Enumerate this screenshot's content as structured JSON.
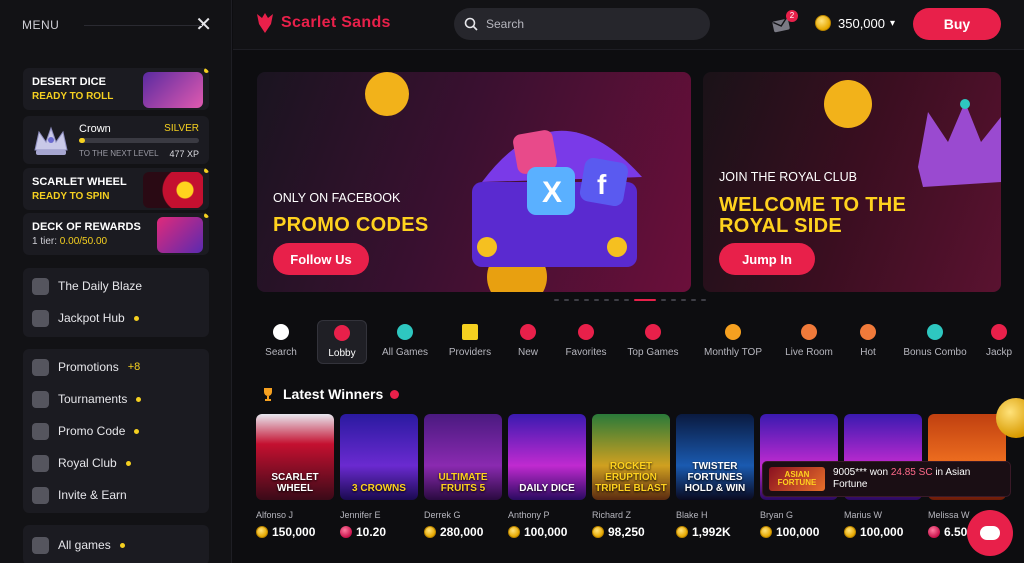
{
  "menu": {
    "label": "MENU"
  },
  "promos": [
    {
      "title": "DESERT DICE",
      "subtitle": "READY TO ROLL"
    },
    {
      "title": "SCARLET WHEEL",
      "subtitle": "READY TO SPIN"
    }
  ],
  "crown": {
    "title": "Crown",
    "level": "SILVER",
    "next_label": "TO THE NEXT LEVEL",
    "xp": "477 XP",
    "progress_fraction": 0.05
  },
  "deck": {
    "title": "DECK OF REWARDS",
    "tier_label": "1 tier:",
    "tier_value": "0.00/50.00"
  },
  "nav_groups": [
    {
      "items": [
        {
          "label": "The Daily Blaze",
          "icon": "calendar-icon",
          "dot": false
        },
        {
          "label": "Jackpot Hub",
          "icon": "jackpot-icon",
          "dot": true
        }
      ]
    },
    {
      "items": [
        {
          "label": "Promotions",
          "icon": "gift-icon",
          "extra": "+8"
        },
        {
          "label": "Tournaments",
          "icon": "trophy-icon",
          "dot": true
        },
        {
          "label": "Promo Code",
          "icon": "ticket-icon",
          "dot": true
        },
        {
          "label": "Royal Club",
          "icon": "crown-icon",
          "dot": true
        },
        {
          "label": "Invite & Earn",
          "icon": "users-icon",
          "dot": false
        }
      ]
    },
    {
      "items": [
        {
          "label": "All games",
          "icon": "gamepad-icon",
          "dot": true
        }
      ]
    }
  ],
  "header": {
    "brand": "Scarlet Sands",
    "search_placeholder": "Search",
    "notification_count": "2",
    "balance": "350,000",
    "buy_label": "Buy"
  },
  "banners": [
    {
      "kicker": "ONLY ON FACEBOOK",
      "headline": "PROMO CODES",
      "cta": "Follow Us"
    },
    {
      "kicker": "JOIN THE ROYAL CLUB",
      "headline_line1": "WELCOME TO THE",
      "headline_line2": "ROYAL SIDE",
      "cta": "Jump In"
    }
  ],
  "carousel": {
    "count": 14,
    "active": 8
  },
  "categories": [
    {
      "label": "Search",
      "icon": "search-icon",
      "color": "#ffffff"
    },
    {
      "label": "Lobby",
      "icon": "lobby-icon",
      "color": "#e8204a",
      "active": true
    },
    {
      "label": "All Games",
      "icon": "gamepad-icon",
      "color": "#2ec7c0"
    },
    {
      "label": "Providers",
      "icon": "star-icon",
      "color": "#f5d020"
    },
    {
      "label": "New",
      "icon": "new-icon",
      "color": "#e8204a"
    },
    {
      "label": "Favorites",
      "icon": "heart-icon",
      "color": "#e8204a"
    },
    {
      "label": "Top Games",
      "icon": "rocket-icon",
      "color": "#e8204a"
    },
    {
      "label": "Monthly TOP",
      "icon": "medal-icon",
      "color": "#f5a020"
    },
    {
      "label": "Live Room",
      "icon": "live-icon",
      "color": "#f07a3a"
    },
    {
      "label": "Hot",
      "icon": "flame-icon",
      "color": "#f07a3a"
    },
    {
      "label": "Bonus Combo",
      "icon": "bomb-icon",
      "color": "#2ec7c0"
    },
    {
      "label": "Jackp",
      "icon": "seven-icon",
      "color": "#e8204a"
    }
  ],
  "latest_winners": {
    "title": "Latest Winners",
    "items": [
      {
        "game": "SCARLET WHEEL",
        "user": "Alfonso J",
        "amount": "150,000",
        "currency": "gc"
      },
      {
        "game": "3 CROWNS",
        "user": "Jennifer E",
        "amount": "10.20",
        "currency": "sc"
      },
      {
        "game": "ULTIMATE FRUITS 5",
        "user": "Derrek G",
        "amount": "280,000",
        "currency": "gc"
      },
      {
        "game": "DAILY DICE",
        "user": "Anthony P",
        "amount": "100,000",
        "currency": "gc"
      },
      {
        "game": "ROCKET ERUPTION TRIPLE BLAST",
        "user": "Richard Z",
        "amount": "98,250",
        "currency": "gc"
      },
      {
        "game": "TWISTER FORTUNES HOLD & WIN",
        "user": "Blake H",
        "amount": "1,992K",
        "currency": "gc"
      },
      {
        "game": "",
        "user": "Bryan G",
        "amount": "100,000",
        "currency": "gc"
      },
      {
        "game": "",
        "user": "Marius W",
        "amount": "100,000",
        "currency": "gc"
      },
      {
        "game": "",
        "user": "Melissa W",
        "amount": "6.50",
        "currency": "sc"
      }
    ]
  },
  "toast": {
    "thumb": "ASIAN FORTUNE",
    "user": "9005***",
    "verb": "won",
    "amount": "24.85 SC",
    "suffix": "in Asian Fortune"
  }
}
